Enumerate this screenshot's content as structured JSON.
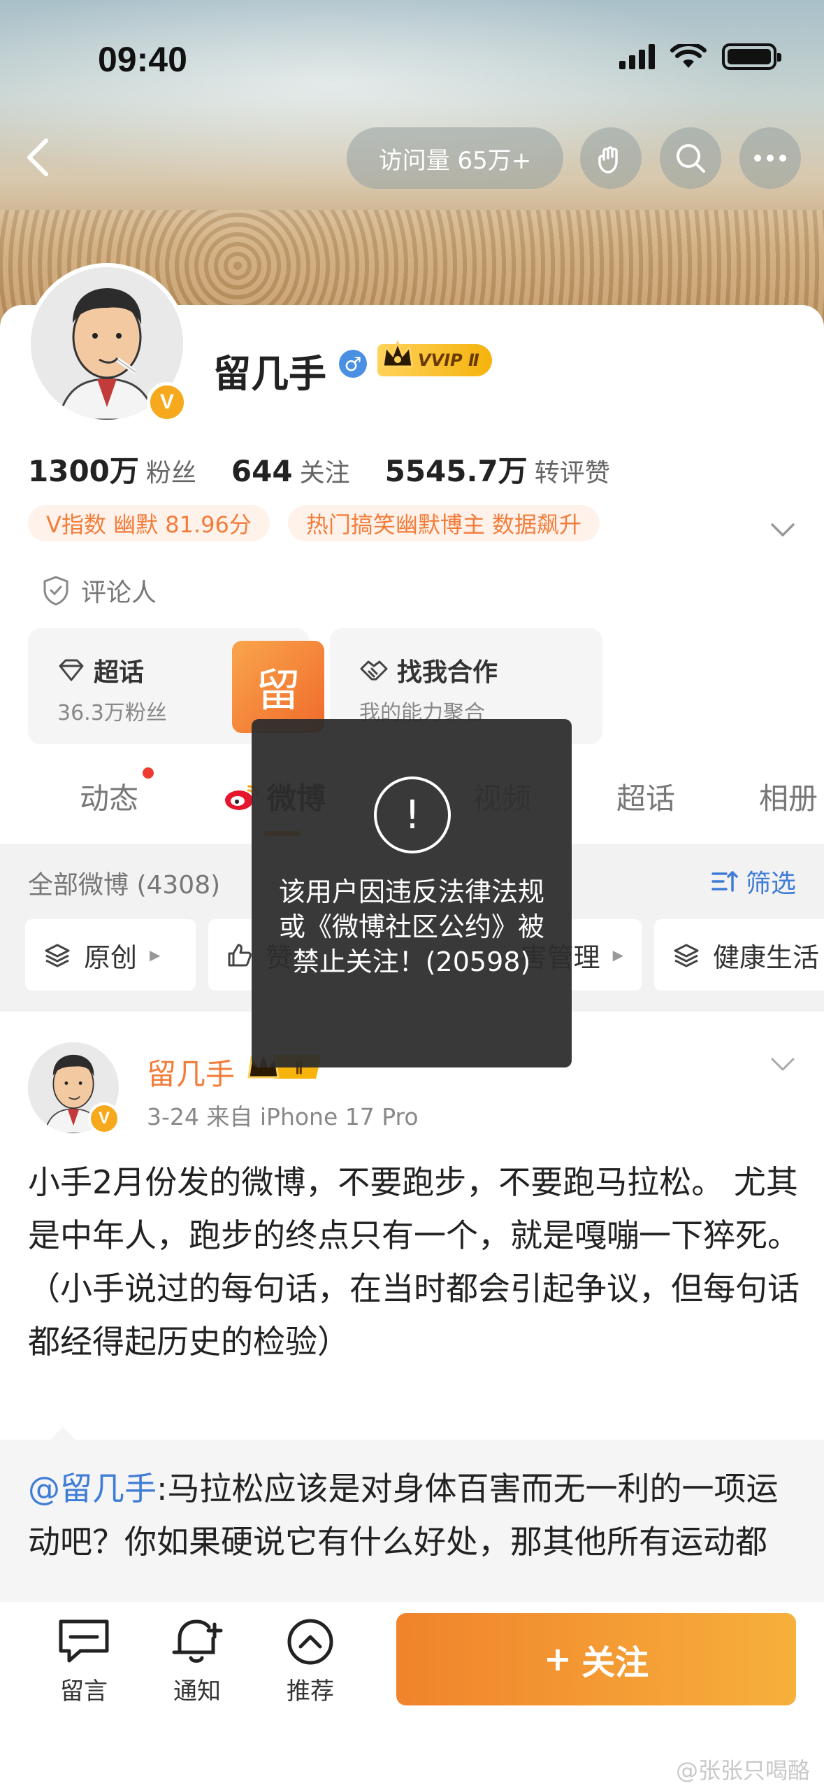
{
  "status_bar": {
    "time": "09:40"
  },
  "header": {
    "visit_label": "访问量 65万+"
  },
  "profile": {
    "name": "留几手",
    "gender_symbol": "♂",
    "vip_badge": "VVIP Ⅱ",
    "avatar_badge": "V",
    "stats": [
      {
        "value": "1300万",
        "label": "粉丝"
      },
      {
        "value": "644",
        "label": "关注"
      },
      {
        "value": "5545.7万",
        "label": "转评赞"
      }
    ],
    "tags": [
      "V指数 幽默 81.96分",
      "热门搞笑幽默博主 数据飙升"
    ],
    "role": "评论人",
    "supertopic": {
      "title": "超话",
      "sub": "36.3万粉丝",
      "tile_char": "留"
    },
    "cooperation": {
      "title": "找我合作",
      "sub": "我的能力聚合"
    }
  },
  "tabs": [
    {
      "label": "动态"
    },
    {
      "label": "微博"
    },
    {
      "label": "视频"
    },
    {
      "label": "超话"
    },
    {
      "label": "相册"
    }
  ],
  "feed_filter": {
    "all_label": "全部微博 (4308)",
    "filter_label": "筛选",
    "chips": [
      "原创",
      "赞",
      "害管理",
      "健康生活"
    ]
  },
  "post": {
    "author": "留几手",
    "crown_text": "Ⅱ",
    "meta": "3-24  来自 iPhone 17 Pro",
    "text": "小手2月份发的微博，不要跑步，不要跑马拉松。 尤其是中年人，跑步的终点只有一个，就是嘎嘣一下猝死。（小手说过的每句话，在当时都会引起争议，但每句话都经得起历史的检验）",
    "quote_at": "@留几手",
    "quote_text": ":马拉松应该是对身体百害而无一利的一项运动吧？你如果硬说它有什么好处，那其他所有运动都"
  },
  "bottom_bar": {
    "items": [
      {
        "label": "留言",
        "icon": "message-icon"
      },
      {
        "label": "通知",
        "icon": "bell-plus-icon"
      },
      {
        "label": "推荐",
        "icon": "chevron-up-circle-icon"
      }
    ],
    "follow_label": "关注",
    "follow_plus": "+"
  },
  "toast": {
    "icon": "!",
    "message": "该用户因违反法律法规或《微博社区公约》被禁止关注！(20598)"
  },
  "watermark": "@张张只喝酪",
  "colors": {
    "accent_orange": "#f27c3a",
    "link_blue": "#3f7cd6",
    "follow_gradient_start": "#f0832b",
    "follow_gradient_end": "#f7b03c",
    "toast_bg": "#2d2d2d"
  }
}
